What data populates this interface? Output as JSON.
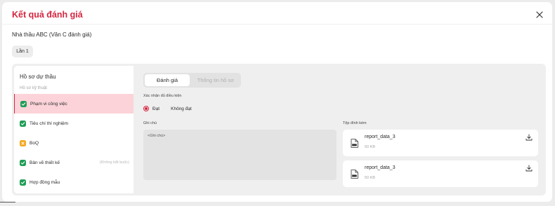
{
  "modal": {
    "title": "Kết quả đánh giá",
    "subtitle": "Nhà thầu ABC (Văn C đánh giá)",
    "round_label": "Lần 1"
  },
  "sidebar": {
    "title": "Hồ sơ dự thầu",
    "section_label": "Hồ sơ kỹ thuật",
    "items": [
      {
        "label": "Phạm vi công việc",
        "status": "done",
        "optional": ""
      },
      {
        "label": "Tiêu chí thí nghiệm",
        "status": "done",
        "optional": ""
      },
      {
        "label": "BoQ",
        "status": "warning",
        "optional": ""
      },
      {
        "label": "Bản vẽ thiết kế",
        "status": "done",
        "optional": "(Không bắt buộc)"
      },
      {
        "label": "Hợp đồng mẫu",
        "status": "done",
        "optional": ""
      }
    ]
  },
  "tabs": {
    "active": "Đánh giá",
    "inactive": "Thông tin hồ sơ"
  },
  "confirm": {
    "label": "Xác nhận đủ điều kiện",
    "option_pass": "Đạt",
    "option_fail": "Không đạt",
    "selected": "Đạt"
  },
  "note": {
    "label": "Ghi chú",
    "placeholder": "<Ghi chú>"
  },
  "attachments": {
    "label": "Tệp đính kèm",
    "files": [
      {
        "name": "report_data_3",
        "size": "50 KB",
        "type": "XLS"
      },
      {
        "name": "report_data_3",
        "size": "50 KB",
        "type": "XLS"
      }
    ]
  },
  "colors": {
    "accent": "#d6263f",
    "success": "#1f9d55",
    "warning": "#f2a81d",
    "active_bg": "#fbd3d8"
  },
  "icons": {
    "close": "close-icon",
    "done": "check-circle-icon",
    "warning": "warning-icon",
    "download": "download-icon",
    "file": "xls-file-icon"
  }
}
